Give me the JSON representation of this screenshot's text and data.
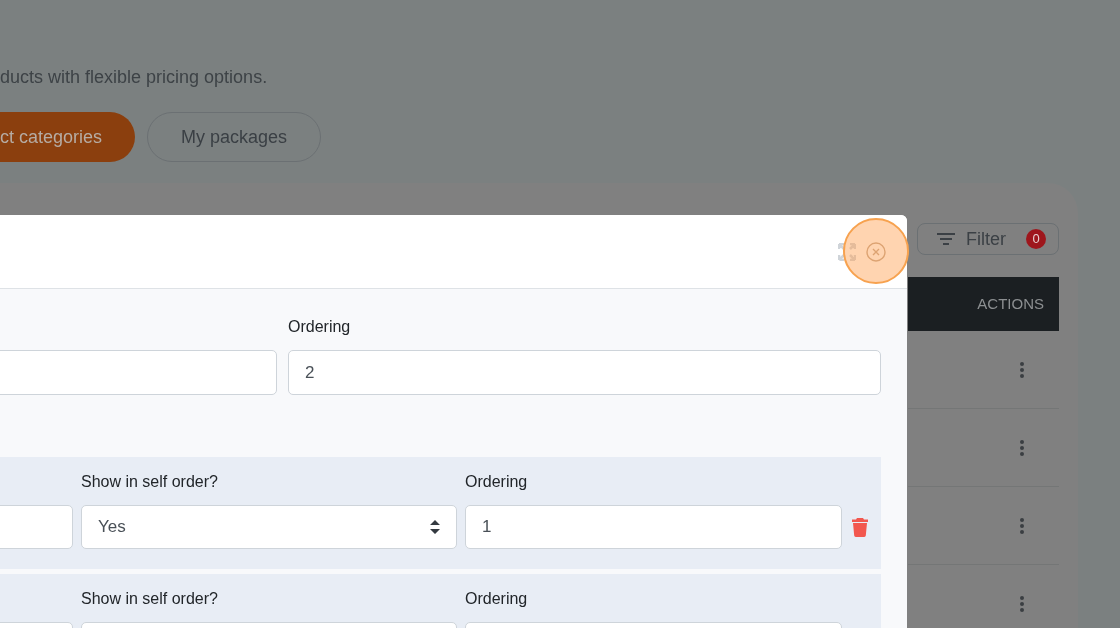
{
  "page": {
    "description": "ducts with flexible pricing options.",
    "tabs": [
      {
        "label": "ct categories",
        "selected": true
      },
      {
        "label": "My packages",
        "selected": false
      }
    ]
  },
  "filter": {
    "label": "Filter",
    "count": "0"
  },
  "table": {
    "columns": [
      "ACTIONS"
    ],
    "rows": [
      {
        "menu": true
      },
      {
        "menu": true
      },
      {
        "menu": true
      },
      {
        "menu": true
      }
    ]
  },
  "modal": {
    "fields": [
      {
        "kind": "input"
      },
      {
        "kind": "input",
        "label": "Ordering",
        "value": "2"
      }
    ],
    "groups": [
      {
        "deletable": true,
        "fields": [
          {
            "kind": "input"
          },
          {
            "kind": "select",
            "label": "Show in self order?",
            "value": "Yes"
          },
          {
            "kind": "input",
            "label": "Ordering",
            "value": "1"
          }
        ]
      },
      {
        "fields": [
          {
            "kind": "input"
          },
          {
            "kind": "select",
            "label": "Show in self order?"
          },
          {
            "kind": "input",
            "label": "Ordering"
          }
        ]
      }
    ]
  }
}
